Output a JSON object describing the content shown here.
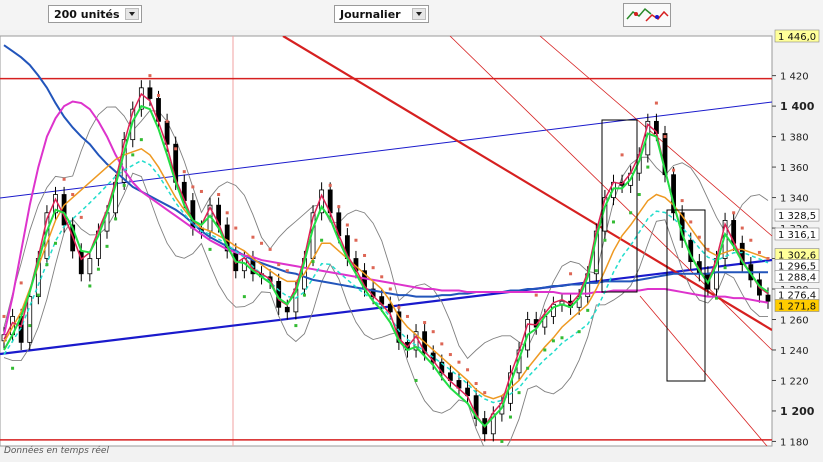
{
  "toolbar": {
    "units_select": "200 unités",
    "period_select": "Journalier",
    "tools_icon": "indicator-tools-icon"
  },
  "footer_note": "Données en temps réel",
  "colors": {
    "background": "#f2f2f2",
    "plot": "#ffffff",
    "red_line": "#d62020",
    "blue_line": "#1a1acc",
    "ma_blue": "#2255bb",
    "ma_magenta": "#dd33cc",
    "ma_orange": "#ee9922",
    "ma_green": "#22dd44",
    "ma_cyan": "#22ddcc",
    "ma_crimson": "#dd2255",
    "sar_green": "#33bb33",
    "sar_red": "#dd6655",
    "bollinger": "#808080"
  },
  "chart_data": {
    "type": "line",
    "ylim": [
      1177,
      1446
    ],
    "y_ticks": [
      "1 180",
      "1 200",
      "1 220",
      "1 240",
      "1 260",
      "1 280",
      "1 300",
      "1 320",
      "1 340",
      "1 360",
      "1 380",
      "1 400",
      "1 420"
    ],
    "y_ticks_bold": [
      "1 200",
      "1 300",
      "1 400"
    ],
    "price_labels": [
      {
        "text": "1 446,0",
        "value": 1446,
        "bg": "#ffff99"
      },
      {
        "text": "1 328,5",
        "value": 1328.5,
        "bg": "#ffffff"
      },
      {
        "text": "1 316,1",
        "value": 1316.1,
        "bg": "#ffffff"
      },
      {
        "text": "1 302,6",
        "value": 1302.6,
        "bg": "#ffff99"
      },
      {
        "text": "1 296,5",
        "value": 1296.5,
        "bg": "#ffffff"
      },
      {
        "text": "1 288,4",
        "value": 1288.4,
        "bg": "#ffffff"
      },
      {
        "text": "1 276,4",
        "value": 1276.4,
        "bg": "#ffffff"
      },
      {
        "text": "1 271,8",
        "value": 1271.8,
        "bg": "#ffcc00"
      }
    ],
    "horizontal_lines": [
      1418,
      1181
    ],
    "close": [
      1250,
      1262,
      1245,
      1275,
      1300,
      1330,
      1342,
      1322,
      1305,
      1290,
      1300,
      1318,
      1330,
      1350,
      1378,
      1398,
      1412,
      1405,
      1390,
      1375,
      1350,
      1338,
      1320,
      1318,
      1335,
      1322,
      1305,
      1292,
      1300,
      1290,
      1288,
      1285,
      1268,
      1265,
      1280,
      1300,
      1330,
      1345,
      1330,
      1315,
      1300,
      1292,
      1280,
      1275,
      1270,
      1265,
      1245,
      1240,
      1252,
      1238,
      1232,
      1225,
      1220,
      1215,
      1210,
      1195,
      1185,
      1198,
      1205,
      1225,
      1240,
      1260,
      1255,
      1262,
      1270,
      1272,
      1268,
      1275,
      1290,
      1318,
      1340,
      1350,
      1348,
      1356,
      1368,
      1390,
      1382,
      1355,
      1330,
      1312,
      1298,
      1290,
      1280,
      1300,
      1325,
      1310,
      1296,
      1286,
      1276,
      1272
    ],
    "ma_blue": [
      1440,
      1436,
      1432,
      1427,
      1420,
      1412,
      1402,
      1393,
      1386,
      1380,
      1375,
      1368,
      1362,
      1357,
      1352,
      1347,
      1344,
      1341,
      1338,
      1335,
      1332,
      1328,
      1323,
      1318,
      1314,
      1311,
      1308,
      1305,
      1302,
      1299,
      1297,
      1295,
      1293,
      1291,
      1290,
      1288,
      1286,
      1285,
      1284,
      1283,
      1282,
      1281,
      1280,
      1279,
      1278,
      1277,
      1276,
      1276,
      1275,
      1275,
      1275,
      1276,
      1276,
      1277,
      1277,
      1278,
      1278,
      1278,
      1278,
      1279,
      1279,
      1280,
      1280,
      1281,
      1282,
      1282,
      1283,
      1283,
      1284,
      1284,
      1285,
      1285,
      1285,
      1285,
      1286,
      1287,
      1288,
      1289,
      1290,
      1290,
      1290,
      1290,
      1290,
      1291,
      1291,
      1291,
      1291,
      1291,
      1291,
      1291
    ],
    "ma_magenta": [
      1250,
      1275,
      1305,
      1335,
      1360,
      1380,
      1392,
      1400,
      1403,
      1402,
      1398,
      1390,
      1380,
      1368,
      1358,
      1350,
      1344,
      1340,
      1336,
      1332,
      1328,
      1324,
      1320,
      1316,
      1312,
      1309,
      1306,
      1304,
      1302,
      1301,
      1299,
      1298,
      1297,
      1296,
      1295,
      1294,
      1293,
      1292,
      1291,
      1290,
      1289,
      1288,
      1287,
      1286,
      1285,
      1284,
      1283,
      1282,
      1281,
      1280,
      1280,
      1279,
      1279,
      1279,
      1278,
      1278,
      1278,
      1278,
      1278,
      1278,
      1278,
      1278,
      1278,
      1278,
      1278,
      1277,
      1277,
      1277,
      1277,
      1278,
      1278,
      1279,
      1279,
      1279,
      1279,
      1280,
      1280,
      1280,
      1279,
      1278,
      1277,
      1276,
      1275,
      1275,
      1275,
      1274,
      1274,
      1273,
      1272,
      1271
    ],
    "ma_orange": [
      1245,
      1255,
      1265,
      1280,
      1295,
      1310,
      1325,
      1335,
      1340,
      1345,
      1350,
      1355,
      1360,
      1365,
      1368,
      1370,
      1372,
      1368,
      1360,
      1350,
      1340,
      1332,
      1325,
      1320,
      1318,
      1315,
      1312,
      1308,
      1305,
      1300,
      1296,
      1292,
      1288,
      1285,
      1285,
      1290,
      1300,
      1310,
      1310,
      1305,
      1300,
      1295,
      1290,
      1285,
      1280,
      1272,
      1262,
      1255,
      1250,
      1245,
      1240,
      1235,
      1230,
      1225,
      1220,
      1214,
      1210,
      1208,
      1210,
      1215,
      1220,
      1228,
      1235,
      1242,
      1248,
      1255,
      1260,
      1265,
      1270,
      1280,
      1292,
      1305,
      1315,
      1322,
      1330,
      1338,
      1342,
      1340,
      1335,
      1328,
      1320,
      1312,
      1305,
      1302,
      1304,
      1306,
      1306,
      1304,
      1302,
      1300
    ],
    "ma_green": [
      1240,
      1250,
      1262,
      1278,
      1298,
      1318,
      1332,
      1330,
      1320,
      1305,
      1304,
      1315,
      1330,
      1348,
      1370,
      1390,
      1400,
      1398,
      1385,
      1368,
      1350,
      1335,
      1325,
      1322,
      1328,
      1320,
      1308,
      1298,
      1297,
      1292,
      1288,
      1284,
      1274,
      1270,
      1278,
      1298,
      1320,
      1334,
      1326,
      1312,
      1300,
      1290,
      1280,
      1272,
      1266,
      1258,
      1246,
      1240,
      1242,
      1236,
      1230,
      1222,
      1215,
      1210,
      1205,
      1196,
      1190,
      1196,
      1202,
      1218,
      1234,
      1250,
      1254,
      1262,
      1268,
      1270,
      1268,
      1274,
      1288,
      1314,
      1334,
      1346,
      1346,
      1352,
      1364,
      1382,
      1380,
      1358,
      1336,
      1316,
      1302,
      1292,
      1284,
      1296,
      1316,
      1308,
      1298,
      1290,
      1282,
      1278
    ]
  }
}
